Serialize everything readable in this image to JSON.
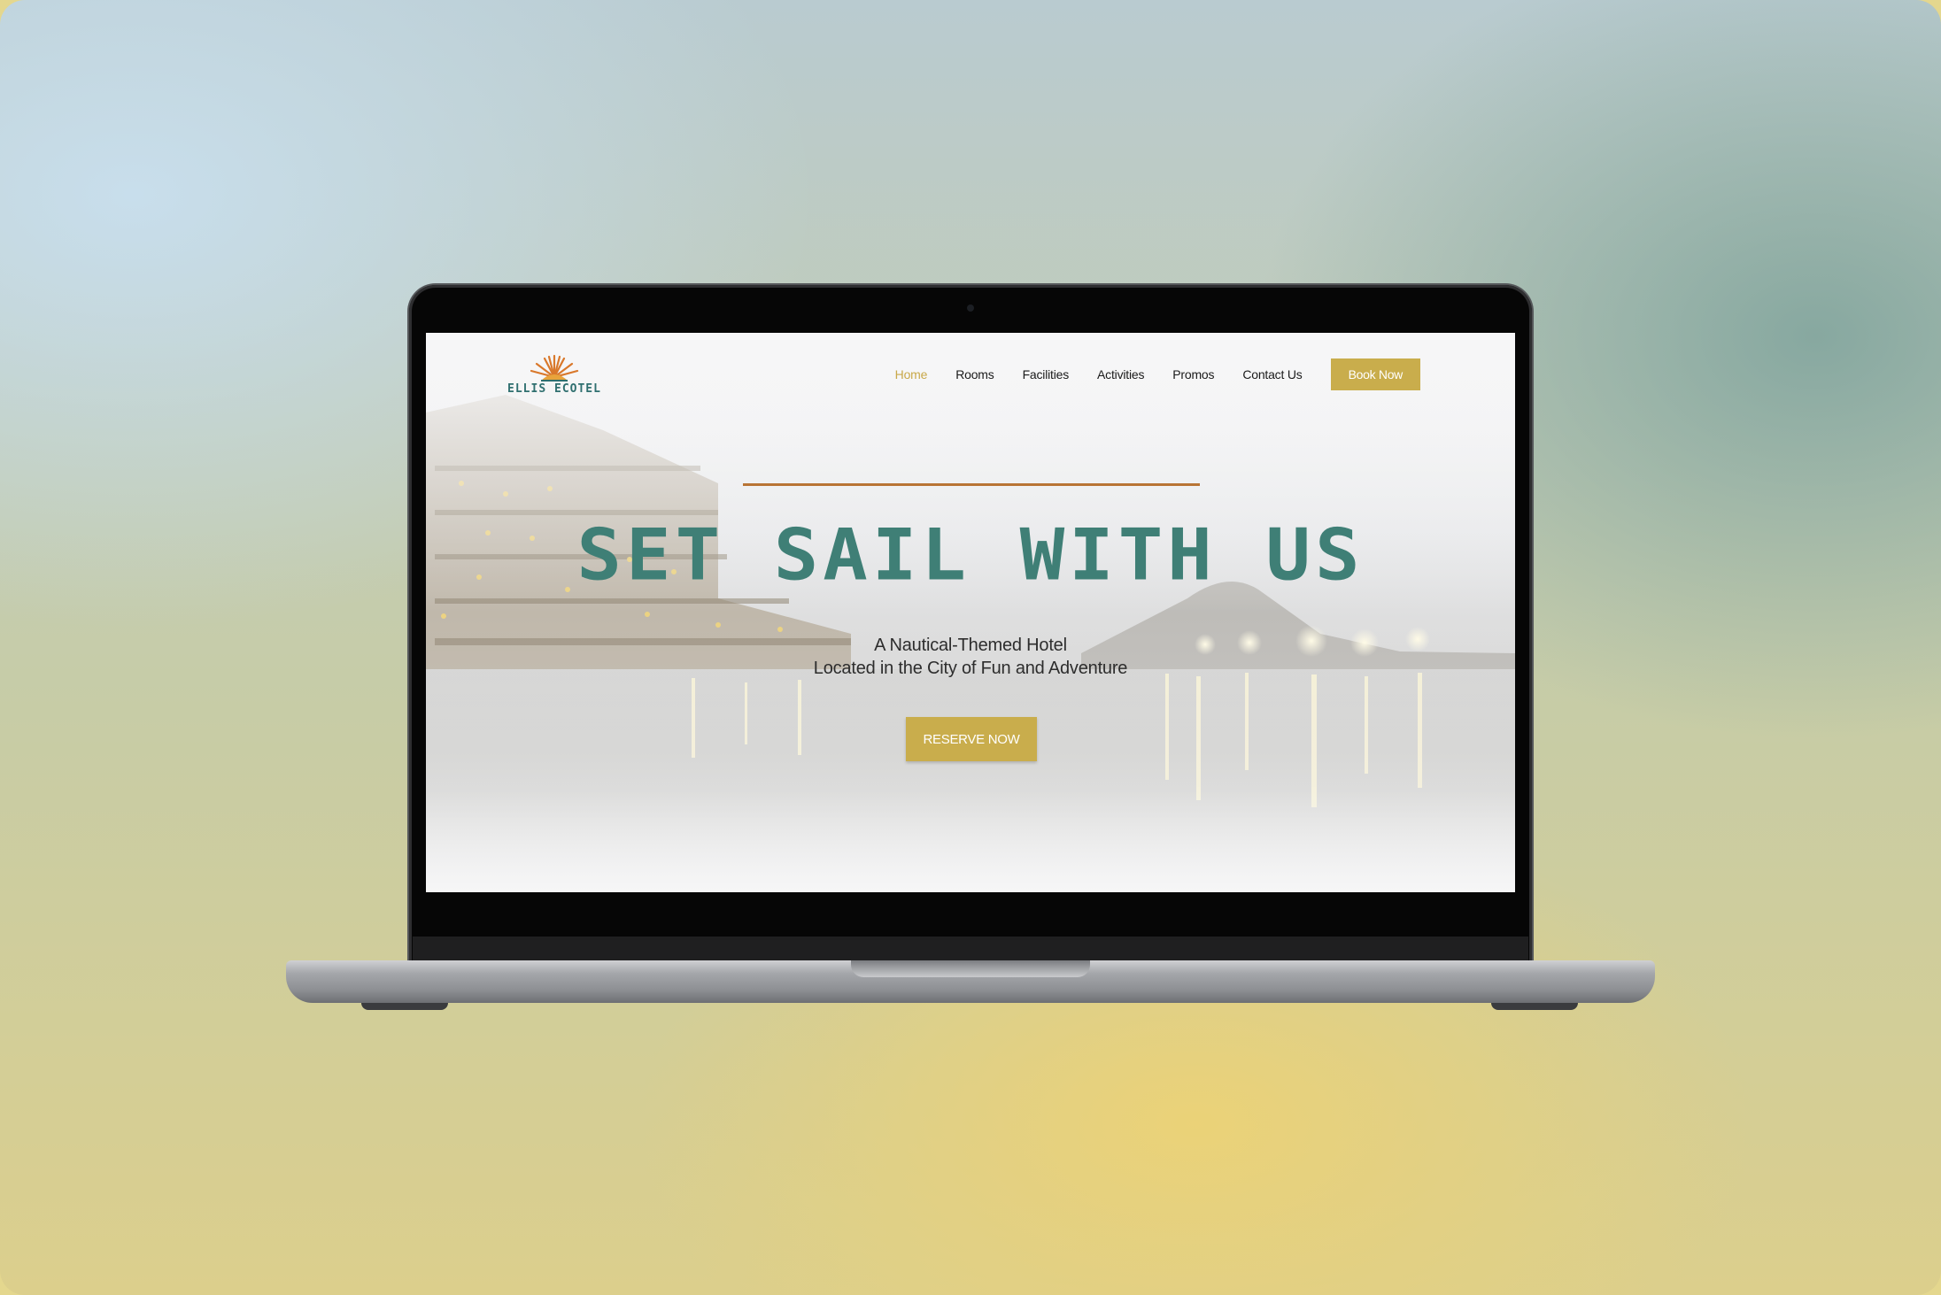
{
  "site": {
    "logo_text": "ELLIS ECOTEL",
    "nav": {
      "items": [
        {
          "label": "Home",
          "active": true
        },
        {
          "label": "Rooms",
          "active": false
        },
        {
          "label": "Facilities",
          "active": false
        },
        {
          "label": "Activities",
          "active": false
        },
        {
          "label": "Promos",
          "active": false
        },
        {
          "label": "Contact Us",
          "active": false
        }
      ],
      "cta_label": "Book Now"
    },
    "hero": {
      "headline": "SET SAIL WITH US",
      "subtitle_line1": "A Nautical-Themed Hotel",
      "subtitle_line2": "Located in the City of Fun and Adventure",
      "cta_label": "RESERVE NOW"
    }
  },
  "colors": {
    "accent_gold": "#c9ad4c",
    "headline_teal": "#3f7f76",
    "rule_copper": "#b87435",
    "logo_teal": "#2f6f6f",
    "logo_sun_orange": "#d9782b"
  },
  "icons": [
    "sun-rays-logo-icon"
  ]
}
